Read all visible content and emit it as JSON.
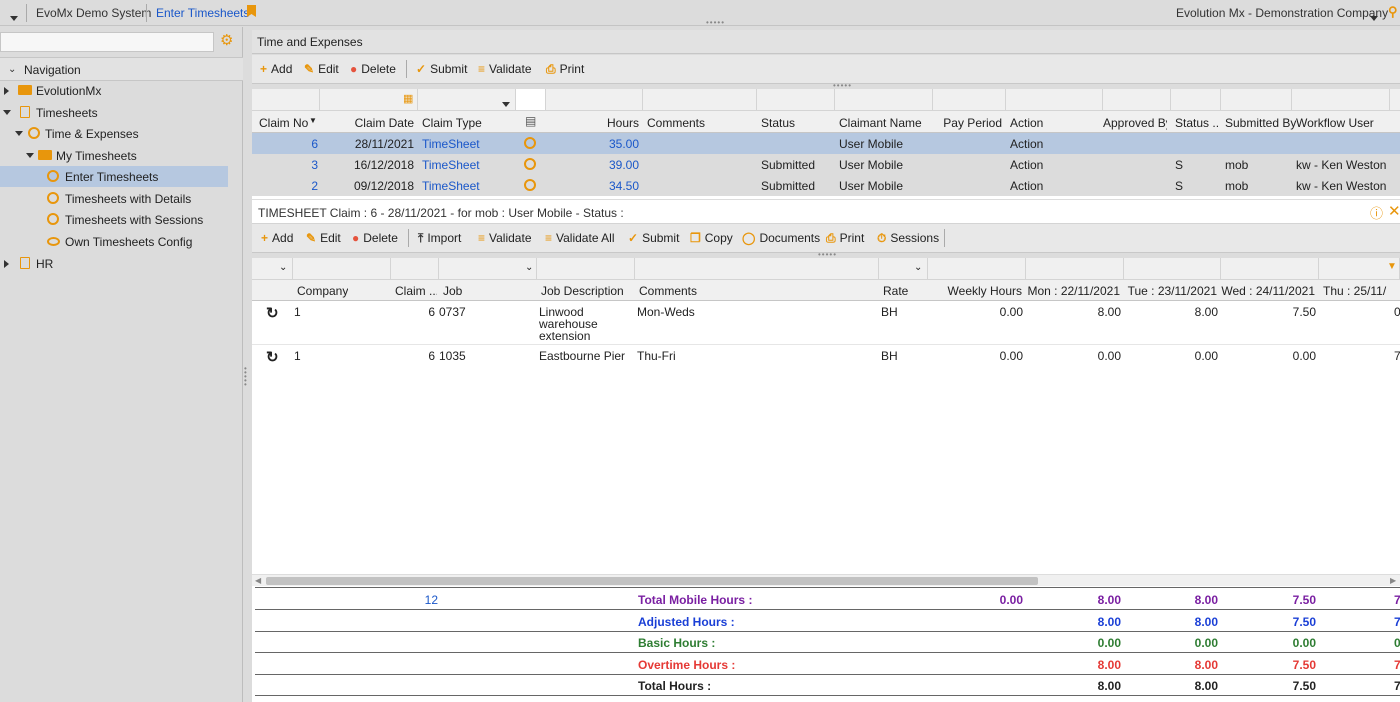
{
  "topbar": {
    "system_name": "EvoMx Demo System",
    "page_link": "Enter Timesheets",
    "company_select": "Evolution Mx - Demonstration Company"
  },
  "sidebar": {
    "heading": "Navigation",
    "items": [
      {
        "label": "EvolutionMx"
      },
      {
        "label": "Timesheets"
      },
      {
        "label": "Time & Expenses"
      },
      {
        "label": "My Timesheets"
      },
      {
        "label": "Enter Timesheets"
      },
      {
        "label": "Timesheets with Details"
      },
      {
        "label": "Timesheets with Sessions"
      },
      {
        "label": "Own Timesheets Config"
      },
      {
        "label": "HR"
      }
    ]
  },
  "claims_panel": {
    "title": "Time and Expenses",
    "toolbar": {
      "add": "Add",
      "edit": "Edit",
      "delete": "Delete",
      "submit": "Submit",
      "validate": "Validate",
      "print": "Print"
    },
    "columns": [
      "Claim No",
      "Claim Date",
      "Claim Type",
      "Hours",
      "Comments",
      "Status",
      "Claimant Name",
      "Pay Period",
      "Action",
      "Approved By",
      "Status ...",
      "Submitted By",
      "Workflow User"
    ],
    "rows": [
      {
        "claim_no": "6",
        "date": "28/11/2021",
        "type": "TimeSheet",
        "hours": "35.00",
        "status": "",
        "claimant": "User Mobile",
        "action": "Action",
        "status2": "",
        "submitted_by": "",
        "workflow_user": ""
      },
      {
        "claim_no": "3",
        "date": "16/12/2018",
        "type": "TimeSheet",
        "hours": "39.00",
        "status": "Submitted",
        "claimant": "User Mobile",
        "action": "Action",
        "status2": "S",
        "submitted_by": "mob",
        "workflow_user": "kw - Ken Weston"
      },
      {
        "claim_no": "2",
        "date": "09/12/2018",
        "type": "TimeSheet",
        "hours": "34.50",
        "status": "Submitted",
        "claimant": "User Mobile",
        "action": "Action",
        "status2": "S",
        "submitted_by": "mob",
        "workflow_user": "kw - Ken Weston"
      }
    ]
  },
  "detail_panel": {
    "title": "TIMESHEET Claim : 6 - 28/11/2021 - for mob : User Mobile - Status :",
    "toolbar": {
      "add": "Add",
      "edit": "Edit",
      "delete": "Delete",
      "import": "Import",
      "validate": "Validate",
      "validate_all": "Validate All",
      "submit": "Submit",
      "copy": "Copy",
      "documents": "Documents",
      "print": "Print",
      "sessions": "Sessions"
    },
    "columns": [
      "Company",
      "Claim ...",
      "Job",
      "Job Description",
      "Comments",
      "Rate",
      "Weekly Hours",
      "Mon : 22/11/2021",
      "Tue : 23/11/2021",
      "Wed : 24/11/2021",
      "Thu : 25/11/"
    ],
    "rows": [
      {
        "company": "1",
        "claim": "6",
        "job": "0737",
        "desc1": "Linwood",
        "desc2": "warehouse",
        "desc3": "extension",
        "comments": "Mon-Weds",
        "rate": "BH",
        "weekly": "0.00",
        "mon": "8.00",
        "tue": "8.00",
        "wed": "7.50",
        "thu": "0"
      },
      {
        "company": "1",
        "claim": "6",
        "job": "1035",
        "desc1": "Eastbourne Pier",
        "desc2": "",
        "desc3": "",
        "comments": "Thu-Fri",
        "rate": "BH",
        "weekly": "0.00",
        "mon": "0.00",
        "tue": "0.00",
        "wed": "0.00",
        "thu": "7"
      }
    ],
    "totals": {
      "count": "12",
      "lines": [
        {
          "label": "Total Mobile Hours :",
          "weekly": "0.00",
          "mon": "8.00",
          "tue": "8.00",
          "wed": "7.50",
          "thu": "7",
          "color": "#7a1fa2"
        },
        {
          "label": "Adjusted Hours :",
          "weekly": "",
          "mon": "8.00",
          "tue": "8.00",
          "wed": "7.50",
          "thu": "7",
          "color": "#1a3fd6"
        },
        {
          "label": "Basic Hours :",
          "weekly": "",
          "mon": "0.00",
          "tue": "0.00",
          "wed": "0.00",
          "thu": "0",
          "color": "#2e7d32"
        },
        {
          "label": "Overtime Hours :",
          "weekly": "",
          "mon": "8.00",
          "tue": "8.00",
          "wed": "7.50",
          "thu": "7",
          "color": "#e53935"
        },
        {
          "label": "Total Hours :",
          "weekly": "",
          "mon": "8.00",
          "tue": "8.00",
          "wed": "7.50",
          "thu": "7",
          "color": "#222222"
        }
      ]
    }
  }
}
